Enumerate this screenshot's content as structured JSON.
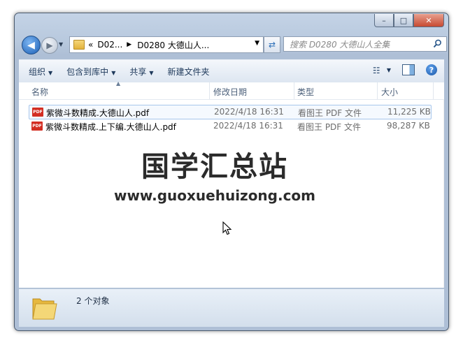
{
  "window": {
    "controls": {
      "minimize": "–",
      "maximize": "□",
      "close": "✕"
    }
  },
  "nav": {
    "back_icon": "◀",
    "forward_icon": "▶",
    "history_icon": "▼",
    "breadcrumb": {
      "overflow": "«",
      "items": [
        "D02...",
        "D0280 大德山人..."
      ],
      "separator": "▶"
    },
    "refresh_icon": "⇄",
    "search_placeholder": "搜索 D0280 大德山人全集",
    "search_icon": "search-icon"
  },
  "toolbar": {
    "organize": "组织",
    "include_in_library": "包含到库中",
    "share": "共享",
    "new_folder": "新建文件夹",
    "dropdown_icon": "▼",
    "view_icon": "☷",
    "help_icon": "?"
  },
  "columns": {
    "name": "名称",
    "date_modified": "修改日期",
    "type": "类型",
    "size": "大小",
    "sort_indicator": "▲"
  },
  "files": [
    {
      "name": "紫微斗数精成.大德山人.pdf",
      "date": "2022/4/18 16:31",
      "type": "看图王 PDF 文件",
      "size": "11,225 KB",
      "icon": "PDF"
    },
    {
      "name": "紫微斗数精成.上下编.大德山人.pdf",
      "date": "2022/4/18 16:31",
      "type": "看图王 PDF 文件",
      "size": "98,287 KB",
      "icon": "PDF"
    }
  ],
  "watermark": {
    "title": "国学汇总站",
    "url": "www.guoxuehuizong.com"
  },
  "status": {
    "count_text": "2 个对象"
  },
  "colors": {
    "accent": "#1e395b",
    "pdf_icon": "#d32e22",
    "folder": "#e3b23c"
  }
}
